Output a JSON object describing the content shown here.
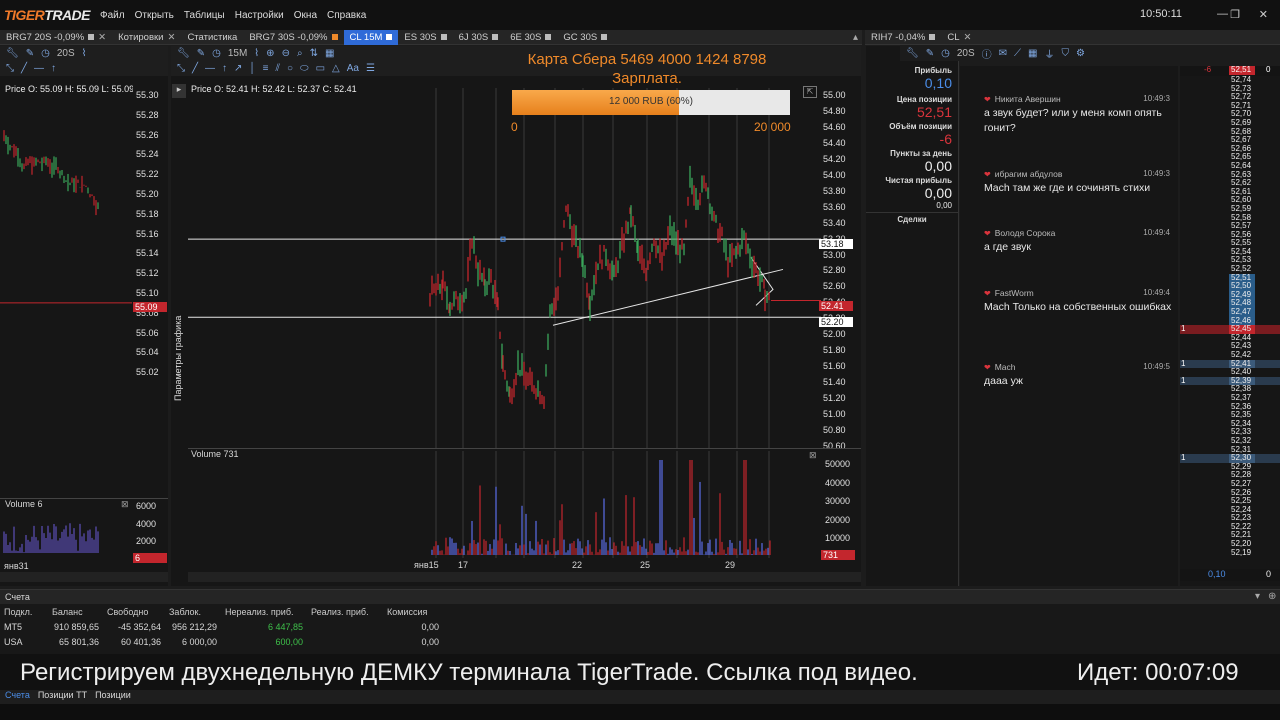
{
  "app": {
    "logo_a": "TIGER",
    "logo_b": "TRADE",
    "clock": "10:50:11"
  },
  "menu": [
    "Файл",
    "Открыть",
    "Таблицы",
    "Настройки",
    "Окна",
    "Справка"
  ],
  "tabs_left": [
    {
      "label": "BRG7 20S -0,09%"
    },
    {
      "label": "Котировки"
    },
    {
      "label": "Статистика"
    },
    {
      "label": "BRG7 30S -0,09%"
    },
    {
      "label": "CL 15M"
    },
    {
      "label": "ES 30S"
    },
    {
      "label": "6J 30S"
    },
    {
      "label": "6E 30S"
    },
    {
      "label": "GC 30S"
    }
  ],
  "tabs_right": [
    {
      "label": "RIH7 -0,04%"
    },
    {
      "label": "CL"
    }
  ],
  "left_chart": {
    "toolbar_interval": "20S",
    "header": "Price O: 55.09 H: 55.09 L: 55.09",
    "price_ticks": [
      "55.30",
      "55.28",
      "55.26",
      "55.24",
      "55.22",
      "55.20",
      "55.18",
      "55.16",
      "55.14",
      "55.12",
      "55.10",
      "55.08",
      "55.06",
      "55.04",
      "55.02"
    ],
    "last_price": "55.09",
    "volume_label": "Volume 6",
    "volume_ticks": [
      "6000",
      "4000",
      "2000",
      "0"
    ],
    "volume_last": "6",
    "date_label": "янв31"
  },
  "main_chart": {
    "toolbar_interval": "15M",
    "header": "Price O: 52.41 H: 52.42 L: 52.37 C: 52.41",
    "side_label": "Параметры графика",
    "overlay_text_1": "Карта Сбера 5469 4000 1424 8798",
    "overlay_text_2": "Зарплата.",
    "progress_text": "12 000 RUB (60%)",
    "progress_fraction": 0.6,
    "progress_min": "0",
    "progress_max": "20 000",
    "price_ticks": [
      "55.00",
      "54.80",
      "54.60",
      "54.40",
      "54.20",
      "54.00",
      "53.80",
      "53.60",
      "53.40",
      "53.20",
      "53.00",
      "52.80",
      "52.60",
      "52.40",
      "52.20",
      "52.00",
      "51.80",
      "51.60",
      "51.40",
      "51.20",
      "51.00",
      "50.80",
      "50.60"
    ],
    "level_1": "53.18",
    "level_2": "52.20",
    "last_price": "52.41",
    "volume_label": "Volume 731",
    "volume_ticks": [
      "50000",
      "40000",
      "30000",
      "20000",
      "10000",
      "0"
    ],
    "volume_last": "731",
    "date_labels": [
      "янв15",
      "17",
      "22",
      "25",
      "29"
    ]
  },
  "position": {
    "profit_label": "Прибыль",
    "profit_value": "0,10",
    "price_label": "Цена позиции",
    "price_value": "52,51",
    "volume_label": "Объём позиции",
    "volume_value": "-6",
    "points_label": "Пункты за день",
    "points_value": "0,00",
    "net_label": "Чистая прибыль",
    "net_value": "0,00",
    "net_sub": "0,00",
    "deals_label": "Сделки"
  },
  "chat": [
    {
      "name": "Никита Авершин",
      "time": "10:49:3",
      "text": "а звук будет? или у меня комп опять гонит?"
    },
    {
      "name": "ибрагим абдулов",
      "time": "10:49:3",
      "text": "Mach там же где и сочинять стихи"
    },
    {
      "name": "Володя Сорока",
      "time": "10:49:4",
      "text": "а где звук"
    },
    {
      "name": "FastWorm",
      "time": "10:49:4",
      "text": "Mach Только на собственных ошибках"
    },
    {
      "name": "Mach",
      "time": "10:49:5",
      "text": "дааа уж"
    }
  ],
  "dom": {
    "header_left": "-6",
    "header_price": "52,51",
    "header_right": "0",
    "prices": [
      "52,74",
      "52,73",
      "52,72",
      "52,71",
      "52,70",
      "52,69",
      "52,68",
      "52,67",
      "52,66",
      "52,65",
      "52,64",
      "52,63",
      "52,62",
      "52,61",
      "52,60",
      "52,59",
      "52,58",
      "52,57",
      "52,56",
      "52,55",
      "52,54",
      "52,53",
      "52,52",
      "52,51",
      "52,50",
      "52,49",
      "52,48",
      "52,47",
      "52,46",
      "52,45",
      "52,44",
      "52,43",
      "52,42",
      "52,41",
      "52,40",
      "52,39",
      "52,38",
      "52,37",
      "52,36",
      "52,35",
      "52,34",
      "52,33",
      "52,32",
      "52,31",
      "52,30",
      "52,29",
      "52,28",
      "52,27",
      "52,26",
      "52,25",
      "52,24",
      "52,23",
      "52,22",
      "52,21",
      "52,20",
      "52,19"
    ],
    "left_values": {
      "52,45": "1",
      "52,41": "1",
      "52,39": "1",
      "52,30": "1"
    },
    "footer_value": "0,10",
    "footer_right": "0"
  },
  "accounts": {
    "title": "Счета",
    "columns": [
      "Подкл.",
      "Баланс",
      "Свободно",
      "Заблок.",
      "Нереализ. приб.",
      "Реализ. приб.",
      "Комиссия"
    ],
    "rows": [
      [
        "MT5",
        "910 859,65",
        "-45 352,64",
        "956 212,29",
        "6 447,85",
        "",
        "0,00"
      ],
      [
        "USA",
        "65 801,36",
        "60 401,36",
        "6 000,00",
        "600,00",
        "",
        "0,00"
      ]
    ]
  },
  "banner": {
    "text": "Регистрируем двухнедельную ДЕМКУ терминала TigerTrade. Ссылка под видео.",
    "timer": "Идет: 00:07:09"
  },
  "bottom_tabs": [
    "Счета",
    "Позиции TT",
    "Позиции"
  ],
  "colors": {
    "accent": "#2f6bd8",
    "orange": "#f08a2a",
    "red_candle": "#c3262d",
    "green_candle": "#3aa65a",
    "neg": "#d9343c",
    "pos": "#3ec04a"
  }
}
